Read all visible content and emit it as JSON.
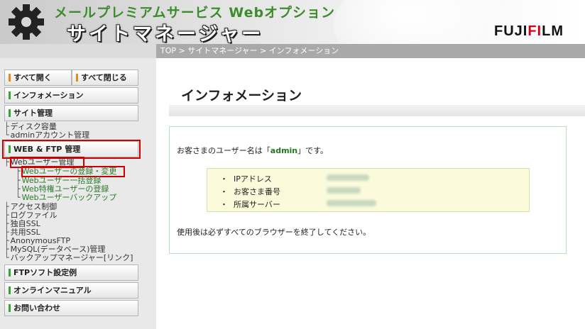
{
  "header": {
    "subtitle": "メールプレミアムサービス Webオプション",
    "title": "サイトマネージャー",
    "brand_left": "FUJI",
    "brand_red": "FI",
    "brand_right": "LM"
  },
  "breadcrumb": "TOP > サイトマネージャー > インフォメーション",
  "sidebar": {
    "expand_all": "すべて開く",
    "collapse_all": "すべて閉じる",
    "information": "インフォメーション",
    "site_management": "サイト管理",
    "site_items": [
      "ディスク容量",
      "adminアカウント管理"
    ],
    "web_ftp": "WEB & FTP 管理",
    "web_user": "Webユーザー管理",
    "web_user_sub": [
      "Webユーザーの登録・変更",
      "Webユーザー一括登録",
      "Web特権ユーザーの登録",
      "Webユーザーバックアップ"
    ],
    "web_ftp_items": [
      "アクセス制御",
      "ログファイル",
      "独自SSL",
      "共用SSL",
      "AnonymousFTP",
      "MySQL(データベース)管理",
      "バックアップマネージャー[リンク]"
    ],
    "ftp_soft": "FTPソフト設定例",
    "online_manual": "オンラインマニュアル",
    "contact": "お問い合わせ"
  },
  "main": {
    "page_title": "インフォメーション",
    "greeting_prefix": "お客さまのユーザー名は「",
    "username": "admin",
    "greeting_suffix": "」です。",
    "details": [
      {
        "bullet": "・",
        "label": "IPアドレス"
      },
      {
        "bullet": "・",
        "label": "お客さま番号"
      },
      {
        "bullet": "・",
        "label": "所属サーバー"
      }
    ],
    "closing_note": "使用後は必ずすべてのブラウザーを終了してください。"
  },
  "colors": {
    "accent_green": "#3aa23a",
    "accent_orange": "#e88a1a",
    "highlight_red": "#d10000"
  }
}
